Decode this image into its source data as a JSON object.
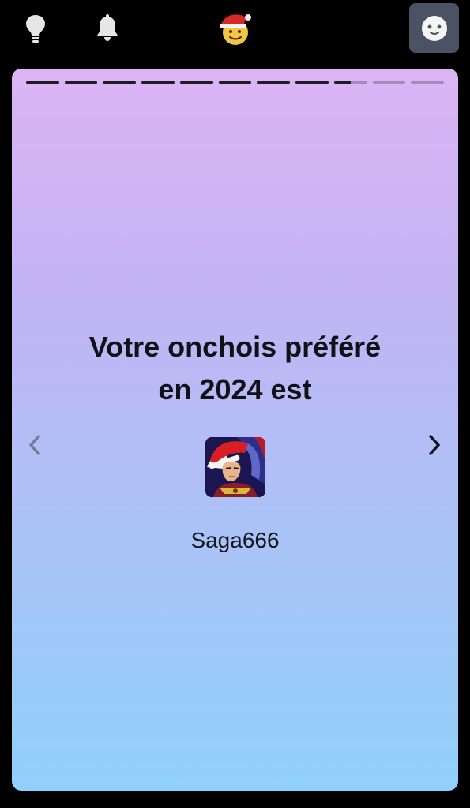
{
  "topbar": {
    "icons": [
      "lightbulb-icon",
      "bell-icon",
      "santa-hat-logo-icon",
      "smiley-avatar-icon"
    ]
  },
  "story": {
    "progress": {
      "total_segments": 11,
      "completed_segments": 8,
      "current_segment_fill": 0.5
    },
    "headline_line1": "Votre onchois préféré",
    "headline_line2": "en 2024 est",
    "username": "Saga666",
    "prev_icon": "chevron-left-icon",
    "next_icon": "chevron-right-icon"
  },
  "colors": {
    "background": "#000000",
    "avatar_button": "#4a5263",
    "card_gradient_top": "#dcb4f4",
    "card_gradient_bottom": "#8fd0fa",
    "text": "#111118"
  }
}
